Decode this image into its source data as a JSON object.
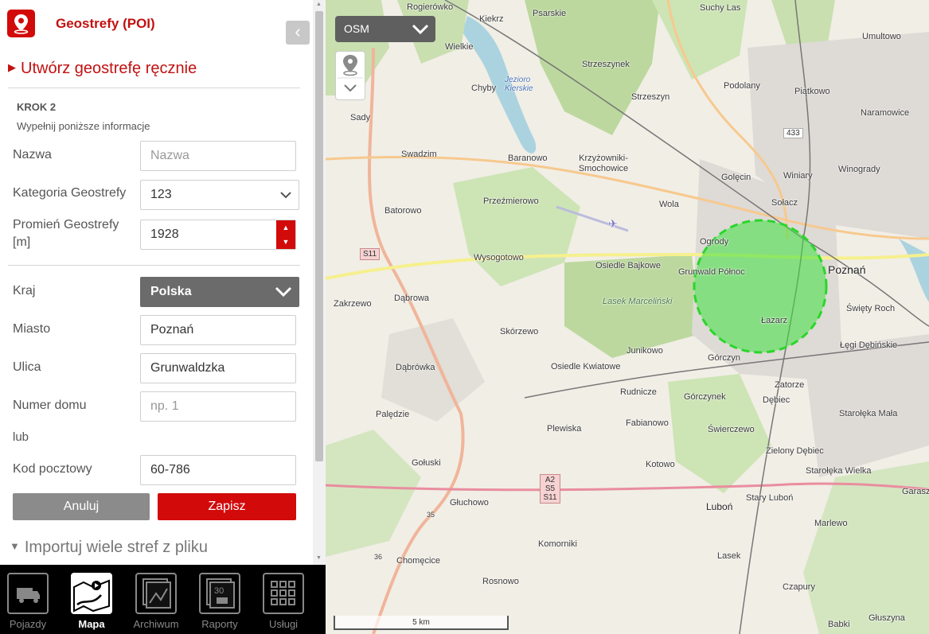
{
  "app": {
    "title": "Geostrefy (POI)"
  },
  "section": {
    "title": "Utwórz geostrefę ręcznie"
  },
  "step": {
    "label": "KROK 2",
    "hint": "Wypełnij poniższe informacje"
  },
  "form": {
    "name": {
      "label": "Nazwa",
      "placeholder": "Nazwa",
      "value": ""
    },
    "category": {
      "label": "Kategoria Geostrefy",
      "value": "123"
    },
    "radius": {
      "label": "Promień Geostrefy [m]",
      "value": "1928"
    },
    "country": {
      "label": "Kraj",
      "value": "Polska"
    },
    "city": {
      "label": "Miasto",
      "value": "Poznań"
    },
    "street": {
      "label": "Ulica",
      "value": "Grunwaldzka"
    },
    "house": {
      "label": "Numer domu",
      "placeholder": "np. 1",
      "value": ""
    },
    "or_label": "lub",
    "postcode": {
      "label": "Kod pocztowy",
      "value": "60-786"
    }
  },
  "buttons": {
    "cancel": "Anuluj",
    "save": "Zapisz"
  },
  "import": {
    "title": "Importuj wiele stref z pliku"
  },
  "nav": [
    {
      "label": "Pojazdy",
      "icon": "truck-icon",
      "active": false
    },
    {
      "label": "Mapa",
      "icon": "map-icon",
      "active": true
    },
    {
      "label": "Archiwum",
      "icon": "archive-icon",
      "active": false
    },
    {
      "label": "Raporty",
      "icon": "reports-icon",
      "active": false
    },
    {
      "label": "Usługi",
      "icon": "grid-icon",
      "active": false
    }
  ],
  "map": {
    "layer": "OSM",
    "scale": "5 km",
    "places": [
      "Rogierówko",
      "Psarskie",
      "Kiekrz",
      "Suchy Las",
      "Umultowo",
      "Wielkie",
      "Strzeszynek",
      "Podolany",
      "Piątkowo",
      "Naramowice",
      "Chyby",
      "Jezioro Kierskie",
      "Strzeszyn",
      "Sady",
      "Swadzim",
      "Baranowo",
      "Krzyżowniki-Smochowice",
      "Golęcin",
      "Winiary",
      "Winogrady",
      "Przeźmierowo",
      "Wola",
      "Sołacz",
      "Batorowo",
      "Ogrody",
      "Wysogotowo",
      "Osiedle Bajkowe",
      "Grunwald Północ",
      "Poznań",
      "Zakrzewo",
      "Dąbrowa",
      "Lasek Marceliński",
      "Święty Roch",
      "Łazarz",
      "Skórzewo",
      "Junikowo",
      "Łęgi Dębińskie",
      "Dąbrówka",
      "Osiedle Kwiatowe",
      "Górczyn",
      "Zatorze",
      "Rudnicze",
      "Górczynek",
      "Dębiec",
      "Palędzie",
      "Fabianowo",
      "Świerczewo",
      "Starołęka Mała",
      "Plewiska",
      "Zielony Dębiec",
      "Gołuski",
      "Kotowo",
      "Starołęka Wielka",
      "Głuchowo",
      "Luboń",
      "Stary Luboń",
      "Garaszewo",
      "Marlewo",
      "Komorniki",
      "Chomęcice",
      "Lasek",
      "Rosnowo",
      "Czapury",
      "Babki",
      "Głuszyna",
      "Plewiska"
    ],
    "roads": [
      "433",
      "S11",
      "A2 S5 S11",
      "35",
      "36"
    ],
    "colors": {
      "geofence": "#3ee23e",
      "accent": "#d20a0a"
    }
  }
}
